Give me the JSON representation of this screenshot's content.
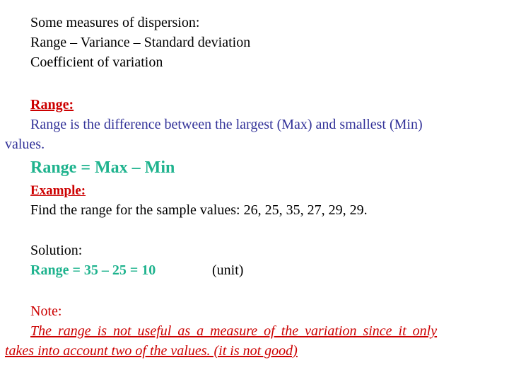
{
  "intro": {
    "line1": "Some measures of dispersion:",
    "line2": "Range – Variance – Standard deviation",
    "line3": "Coefficient of variation"
  },
  "range_section": {
    "heading": "Range:",
    "definition_line1": "Range is the difference between the largest (Max) and smallest (Min)",
    "definition_line2": "values.",
    "formula": "Range = Max – Min"
  },
  "example": {
    "heading": "Example:",
    "prompt": "Find the range for the sample values:  26, 25, 35, 27, 29, 29.",
    "sample_values": [
      26,
      25,
      35,
      27,
      29,
      29
    ]
  },
  "solution": {
    "label": "Solution:",
    "result": "Range = 35 – 25 = 10",
    "unit": "(unit)"
  },
  "note": {
    "label": "Note:",
    "text_line1": "The range is not useful as a measure of the variation since it only",
    "text_line2": "takes into account two of the values. (it is not good)"
  },
  "colors": {
    "heading_red": "#cc0000",
    "definition_blue": "#333399",
    "formula_teal": "#1fb38e"
  }
}
